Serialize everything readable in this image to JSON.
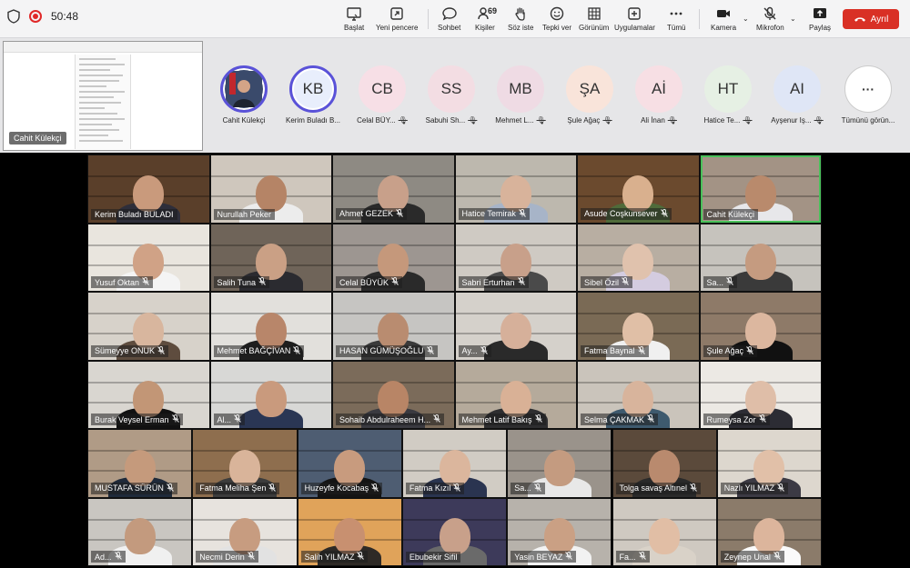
{
  "meeting": {
    "timer": "50:48"
  },
  "toolbar": {
    "buttons": [
      {
        "label": "Başlat",
        "icon": "monitor-icon"
      },
      {
        "label": "Yeni pencere",
        "icon": "open-window-icon"
      },
      {
        "label": "Sohbet",
        "icon": "chat-icon"
      },
      {
        "label": "Kişiler",
        "icon": "people-icon",
        "count": "69"
      },
      {
        "label": "Söz iste",
        "icon": "raise-hand-icon"
      },
      {
        "label": "Tepki ver",
        "icon": "smiley-icon"
      },
      {
        "label": "Görünüm",
        "icon": "grid-icon"
      },
      {
        "label": "Uygulamalar",
        "icon": "apps-plus-icon"
      },
      {
        "label": "Tümü",
        "icon": "more-icon"
      },
      {
        "label": "Kamera",
        "icon": "camera-icon"
      },
      {
        "label": "Mikrofon",
        "icon": "mic-off-icon"
      },
      {
        "label": "Paylaş",
        "icon": "share-icon"
      }
    ],
    "leave_label": "Ayrıl",
    "leave_color": "#d93025"
  },
  "strip": {
    "shared_name": "Cahit Külekçi",
    "avatars": [
      {
        "initials": "",
        "label": "Cahit Külekçi",
        "color": "#3a4a6b",
        "muted": false
      },
      {
        "initials": "KB",
        "label": "Kerim Buladı B...",
        "color": "#e8eefc",
        "muted": false
      },
      {
        "initials": "CB",
        "label": "Celal BÜY...",
        "color": "#f7dfe6",
        "muted": true
      },
      {
        "initials": "SS",
        "label": "Sabuhi Sh...",
        "color": "#f3dde3",
        "muted": true
      },
      {
        "initials": "MB",
        "label": "Mehmet L...",
        "color": "#efdbe4",
        "muted": true
      },
      {
        "initials": "ŞA",
        "label": "Şule Ağaç",
        "color": "#f9e4da",
        "muted": true
      },
      {
        "initials": "Aİ",
        "label": "Ali İnan",
        "color": "#f7dfe4",
        "muted": true
      },
      {
        "initials": "HT",
        "label": "Hatice Te...",
        "color": "#e6f0e4",
        "muted": true
      },
      {
        "initials": "AI",
        "label": "Ayşenur Iş...",
        "color": "#dfe6f6",
        "muted": true
      },
      {
        "initials": "···",
        "label": "Tümünü görün...",
        "color": "#ffffff",
        "muted": false
      }
    ]
  },
  "grid": {
    "rows": [
      [
        {
          "name": "Kerim Buladı BULADI",
          "muted": false,
          "active": false,
          "bg": "#5a3f2a",
          "skin": "#c99a7c",
          "shirt": "#2e2e3a"
        },
        {
          "name": "Nurullah Peker",
          "muted": false,
          "active": false,
          "bg": "#cfc7bd",
          "skin": "#b58466",
          "shirt": "#ececec"
        },
        {
          "name": "Ahmet GEZEK",
          "muted": true,
          "active": false,
          "bg": "#8e8a83",
          "skin": "#c8a08a",
          "shirt": "#2a2a2a"
        },
        {
          "name": "Hatice Temirak",
          "muted": true,
          "active": false,
          "bg": "#bdb8ae",
          "skin": "#d8b39b",
          "shirt": "#a7b4c8"
        },
        {
          "name": "Asude Coşkunsever",
          "muted": true,
          "active": false,
          "bg": "#6b4a2e",
          "skin": "#d9b08e",
          "shirt": "#4f6b3a"
        },
        {
          "name": "Cahit Külekçi",
          "muted": false,
          "active": true,
          "bg": "#a39385",
          "skin": "#b98a6c",
          "shirt": "#e7e7ea"
        }
      ],
      [
        {
          "name": "Yusuf Oktan",
          "muted": true,
          "active": false,
          "bg": "#e9e5de",
          "skin": "#d0a286",
          "shirt": "#f4f4f4"
        },
        {
          "name": "Salih Tuna",
          "muted": true,
          "active": false,
          "bg": "#6f6459",
          "skin": "#caa085",
          "shirt": "#2b2b30"
        },
        {
          "name": "Celal BÜYÜK",
          "muted": true,
          "active": false,
          "bg": "#9d9691",
          "skin": "#c5987b",
          "shirt": "#2a2a2a"
        },
        {
          "name": "Sabri Erturhan",
          "muted": true,
          "active": false,
          "bg": "#cfcac3",
          "skin": "#c8a08a",
          "shirt": "#4a4a4a"
        },
        {
          "name": "Sibel Özil",
          "muted": true,
          "active": false,
          "bg": "#b8aea2",
          "skin": "#e0c2ad",
          "shirt": "#d4cce0"
        },
        {
          "name": "Sa...",
          "muted": true,
          "active": false,
          "bg": "#c6c3bd",
          "skin": "#c59b80",
          "shirt": "#3a3a3a"
        }
      ],
      [
        {
          "name": "Sümeyye ONUK",
          "muted": true,
          "active": false,
          "bg": "#d7d2ca",
          "skin": "#d8b69e",
          "shirt": "#5e4c3e"
        },
        {
          "name": "Mehmet BAĞÇİVAN",
          "muted": true,
          "active": false,
          "bg": "#e2e0dc",
          "skin": "#b8866a",
          "shirt": "#1e1e1e"
        },
        {
          "name": "HASAN GÜMÜŞOĞLU",
          "muted": true,
          "active": false,
          "bg": "#c6c5c2",
          "skin": "#b98c70",
          "shirt": "#3a3a3a"
        },
        {
          "name": "Ay...",
          "muted": true,
          "active": false,
          "bg": "#d5d1cb",
          "skin": "#d6b09a",
          "shirt": "#2a2a2a"
        },
        {
          "name": "Fatma Baynal",
          "muted": true,
          "active": false,
          "bg": "#7a6a55",
          "skin": "#e0bfa6",
          "shirt": "#f0f0f0"
        },
        {
          "name": "Şule Ağaç",
          "muted": true,
          "active": false,
          "bg": "#8e7a68",
          "skin": "#dcb79f",
          "shirt": "#111111"
        }
      ],
      [
        {
          "name": "Burak Veysel Erman",
          "muted": true,
          "active": false,
          "bg": "#d9d6d0",
          "skin": "#c29676",
          "shirt": "#111111"
        },
        {
          "name": "Al...",
          "muted": true,
          "active": false,
          "bg": "#d8d8d6",
          "skin": "#c99a7d",
          "shirt": "#2a3654"
        },
        {
          "name": "Sohaib Abdulraheem H...",
          "muted": true,
          "active": false,
          "bg": "#7b6b5a",
          "skin": "#b88566",
          "shirt": "#3a3a40"
        },
        {
          "name": "Mehmet Latif Bakış",
          "muted": true,
          "active": false,
          "bg": "#b5aa9b",
          "skin": "#d9b196",
          "shirt": "#2e2e30"
        },
        {
          "name": "Selma ÇAKMAK",
          "muted": true,
          "active": false,
          "bg": "#cac4bb",
          "skin": "#d8b49c",
          "shirt": "#3e5a6e"
        },
        {
          "name": "Rumeysa Zor",
          "muted": true,
          "active": false,
          "bg": "#ece9e4",
          "skin": "#dfbea8",
          "shirt": "#2c2c34"
        }
      ],
      [
        {
          "name": "MUSTAFA SÜRÜN",
          "muted": true,
          "active": false,
          "bg": "#b09b86",
          "skin": "#c59a7c",
          "shirt": "#1f2a3a"
        },
        {
          "name": "Fatma Meliha Şen",
          "muted": true,
          "active": false,
          "bg": "#8e6e4e",
          "skin": "#d9b49a",
          "shirt": "#3c3c3c"
        },
        {
          "name": "Huzeyfe Kocabaş",
          "muted": true,
          "active": false,
          "bg": "#4e5d72",
          "skin": "#c89b7e",
          "shirt": "#141414"
        },
        {
          "name": "Fatma Kızıl",
          "muted": true,
          "active": false,
          "bg": "#d1ccc4",
          "skin": "#dbb69d",
          "shirt": "#2a3450"
        },
        {
          "name": "Sa...",
          "muted": true,
          "active": false,
          "bg": "#9a938b",
          "skin": "#c49b80",
          "shirt": "#e8e8e8"
        },
        {
          "name": "Tolga savaş Altınel",
          "muted": true,
          "active": false,
          "bg": "#5b4a3b",
          "skin": "#b98a6e",
          "shirt": "#2a2a2a"
        },
        {
          "name": "Nazlı YILMAZ",
          "muted": true,
          "active": false,
          "bg": "#ddd7ce",
          "skin": "#e1c0a8",
          "shirt": "#3c3a44"
        }
      ],
      [
        {
          "name": "Ad...",
          "muted": true,
          "active": false,
          "bg": "#c9c6c1",
          "skin": "#c39a7e",
          "shirt": "#f0f0f0"
        },
        {
          "name": "Necmi Derin",
          "muted": true,
          "active": false,
          "bg": "#e7e3de",
          "skin": "#c79c80",
          "shirt": "#e2e2e2"
        },
        {
          "name": "Salih YILMAZ",
          "muted": true,
          "active": false,
          "bg": "#e0a35a",
          "skin": "#c89070",
          "shirt": "#2e2a26"
        },
        {
          "name": "Ebubekir Sifil",
          "muted": false,
          "active": false,
          "bg": "#3d3a5a",
          "skin": "#c8a08a",
          "shirt": "#6a6a6a"
        },
        {
          "name": "Yasin BEYAZ",
          "muted": true,
          "active": false,
          "bg": "#b7b2ab",
          "skin": "#caa084",
          "shirt": "#f2f2f2"
        },
        {
          "name": "Fa...",
          "muted": true,
          "active": false,
          "bg": "#cfc9c1",
          "skin": "#e1bea5",
          "shirt": "#d9d2c8"
        },
        {
          "name": "Zeynep Unal",
          "muted": true,
          "active": false,
          "bg": "#8b7b6a",
          "skin": "#dcb59c",
          "shirt": "#fafafa"
        }
      ]
    ]
  }
}
